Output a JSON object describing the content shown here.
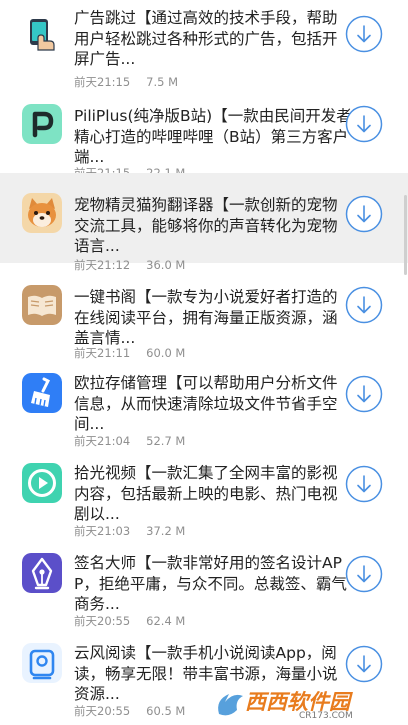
{
  "list": {
    "items": [
      {
        "icon": "phone-hand-icon",
        "desc": "广告跳过【通过高效的技术手段，帮助用户轻松跳过各种形式的广告，包括开屏广告...",
        "time": "前天21:15",
        "size": "7.5 M"
      },
      {
        "icon": "pilipala-p-icon",
        "desc": "PiliPlus(纯净版B站)【一款由民间开发者精心打造的哔哩哔哩（B站）第三方客户端...",
        "time": "前天21:15",
        "size": "22.1 M"
      },
      {
        "icon": "shiba-dog-icon",
        "desc": "宠物精灵猫狗翻译器【一款创新的宠物交流工具，能够将你的声音转化为宠物语言...",
        "time": "前天21:12",
        "size": "36.0 M"
      },
      {
        "icon": "open-book-icon",
        "desc": "一键书阁【一款专为小说爱好者打造的在线阅读平台，拥有海量正版资源，涵盖言情...",
        "time": "前天21:11",
        "size": "60.0 M"
      },
      {
        "icon": "broom-icon",
        "desc": " 欧拉存储管理【可以帮助用户分析文件信息，从而快速清除垃圾文件节省手空间...",
        "time": "前天21:04",
        "size": "52.7 M"
      },
      {
        "icon": "play-icon",
        "desc": "拾光视频【一款汇集了全网丰富的影视内容，包括最新上映的电影、热门电视剧以...",
        "time": "前天21:03",
        "size": "37.2 M"
      },
      {
        "icon": "pen-nib-icon",
        "desc": "签名大师【一款非常好用的签名设计APP，拒绝平庸，与众不同。总裁签、霸气商务...",
        "time": "前天20:55",
        "size": "62.4 M"
      },
      {
        "icon": "reader-icon",
        "desc": "云风阅读【一款手机小说阅读App，阅读，畅享无限！带丰富书源，海量小说资源...",
        "time": "前天20:55",
        "size": "60.5 M"
      }
    ]
  },
  "watermark": {
    "text": "西西软件园",
    "url": "CR173.COM"
  },
  "colors": {
    "accent": "#4a90e2",
    "meta_text": "#8f8f8f",
    "highlight_row": "#efefef"
  }
}
